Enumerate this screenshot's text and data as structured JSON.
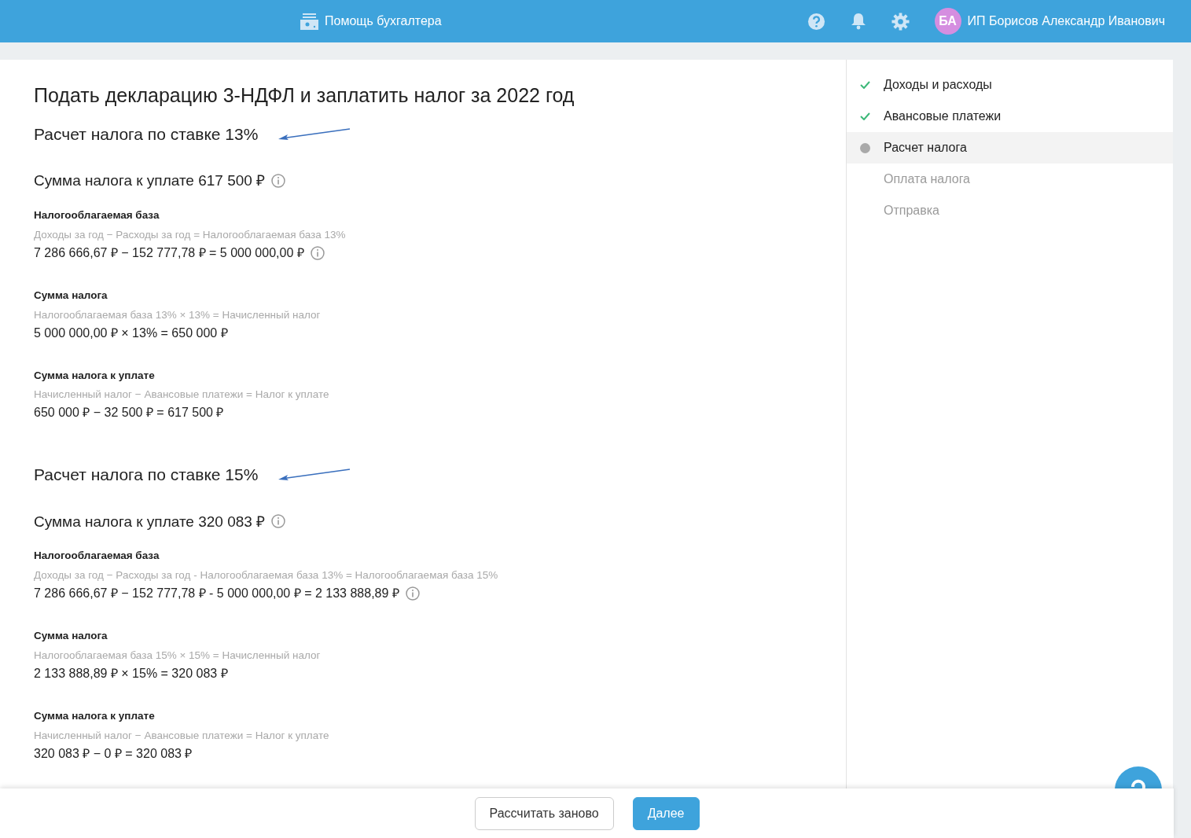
{
  "header": {
    "app_title": "Помощь бухгалтера",
    "avatar_initials": "БА",
    "user_name": "ИП Борисов Александр Иванович"
  },
  "page_title": "Подать декларацию 3-НДФЛ и заплатить налог за 2022 год",
  "sections": [
    {
      "heading": "Расчет налога по ставке 13%",
      "total": "Сумма налога к уплате 617 500 ₽",
      "blocks": [
        {
          "label": "Налогооблагаемая база",
          "formula": "Доходы за год − Расходы за год = Налогооблагаемая база 13%",
          "calc": "7 286 666,67 ₽ − 152 777,78 ₽ = 5 000 000,00 ₽",
          "info": true
        },
        {
          "label": "Сумма налога",
          "formula": "Налогооблагаемая база 13% × 13% = Начисленный налог",
          "calc": "5 000 000,00 ₽ × 13% = 650 000 ₽",
          "info": false
        },
        {
          "label": "Сумма налога к уплате",
          "formula": "Начисленный налог − Авансовые платежи = Налог к уплате",
          "calc": "650 000 ₽ − 32 500 ₽ = 617 500 ₽",
          "info": false
        }
      ]
    },
    {
      "heading": "Расчет налога по ставке 15%",
      "total": "Сумма налога к уплате 320 083 ₽",
      "blocks": [
        {
          "label": "Налогооблагаемая база",
          "formula": "Доходы за год − Расходы за год - Налогооблагаемая база 13% = Налогооблагаемая база 15%",
          "calc": "7 286 666,67 ₽ − 152 777,78 ₽ - 5 000 000,00 ₽ = 2 133 888,89 ₽",
          "info": true
        },
        {
          "label": "Сумма налога",
          "formula": "Налогооблагаемая база 15% × 15% = Начисленный налог",
          "calc": "2 133 888,89 ₽ × 15% = 320 083 ₽",
          "info": false
        },
        {
          "label": "Сумма налога к уплате",
          "formula": "Начисленный налог − Авансовые платежи = Налог к уплате",
          "calc": "320 083 ₽ − 0 ₽ = 320 083 ₽",
          "info": false
        }
      ]
    }
  ],
  "steps": [
    {
      "label": "Доходы и расходы",
      "done": true,
      "selected": false,
      "disabled": false
    },
    {
      "label": "Авансовые платежи",
      "done": true,
      "selected": false,
      "disabled": false
    },
    {
      "label": "Расчет налога",
      "done": false,
      "selected": true,
      "disabled": false
    },
    {
      "label": "Оплата налога",
      "done": false,
      "selected": false,
      "disabled": true
    },
    {
      "label": "Отправка",
      "done": false,
      "selected": false,
      "disabled": true
    }
  ],
  "footer": {
    "buttons": [
      {
        "label": "Рассчитать заново",
        "kind": "secondary"
      },
      {
        "label": "Далее",
        "kind": "primary"
      }
    ]
  }
}
